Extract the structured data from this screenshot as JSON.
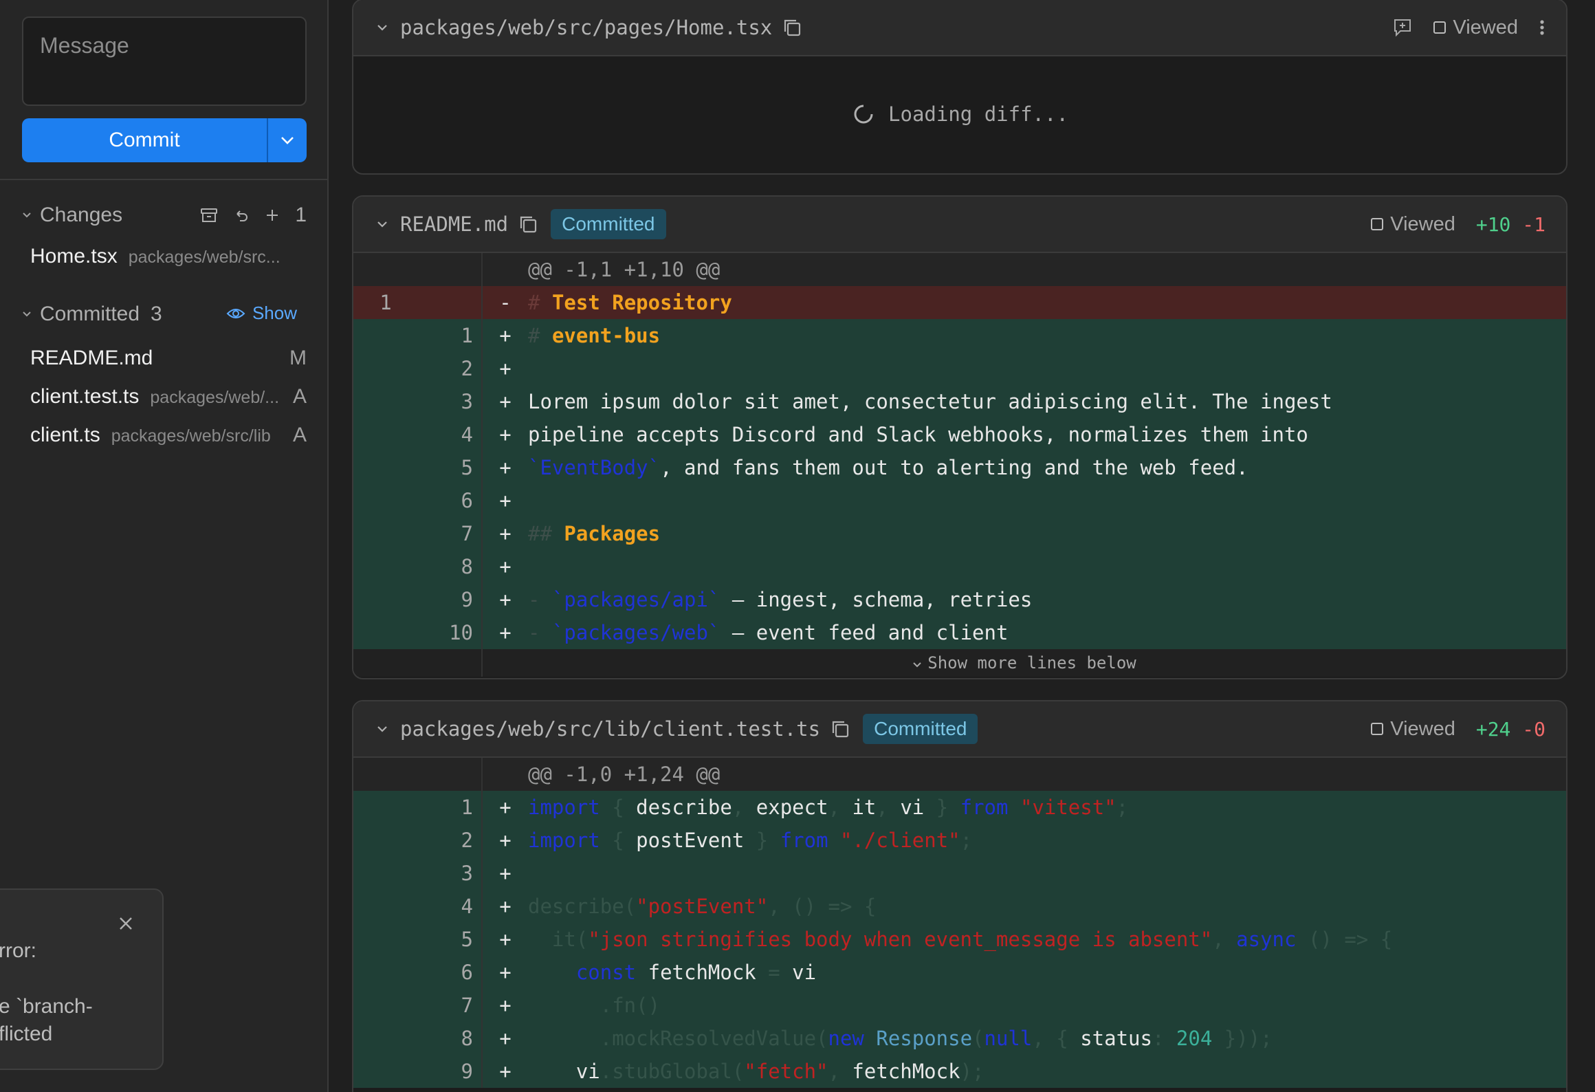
{
  "sidebar": {
    "message_placeholder": "Message",
    "commit_label": "Commit",
    "changes": {
      "title": "Changes",
      "count": "1",
      "files": [
        {
          "name": "Home.tsx",
          "path": "packages/web/src..."
        }
      ]
    },
    "committed": {
      "title": "Committed",
      "count": "3",
      "show_label": "Show",
      "files": [
        {
          "name": "README.md",
          "path": "",
          "status": "M"
        },
        {
          "name": "client.test.ts",
          "path": "packages/web/...",
          "status": "A"
        },
        {
          "name": "client.ts",
          "path": "packages/web/src/lib",
          "status": "A"
        }
      ]
    },
    "toast": {
      "line1": "rror:",
      "line2": "e `branch-",
      "line3": "flicted"
    }
  },
  "diffs": [
    {
      "file": "packages/web/src/pages/Home.tsx",
      "viewed_label": "Viewed",
      "loading_text": "Loading diff..."
    },
    {
      "file": "README.md",
      "badge": "Committed",
      "viewed_label": "Viewed",
      "additions": "+10",
      "deletions": "-1",
      "hunk": "@@ -1,1 +1,10 @@",
      "more_label": "Show more lines below"
    },
    {
      "file": "packages/web/src/lib/client.test.ts",
      "badge": "Committed",
      "viewed_label": "Viewed",
      "additions": "+24",
      "deletions": "-0",
      "hunk": "@@ -1,0 +1,24 @@"
    }
  ],
  "colors": {
    "accent": "#1d7ff0",
    "added_bg": "#1f3f36",
    "removed_bg": "#4a2322",
    "badge_bg": "#1e4a5c"
  }
}
